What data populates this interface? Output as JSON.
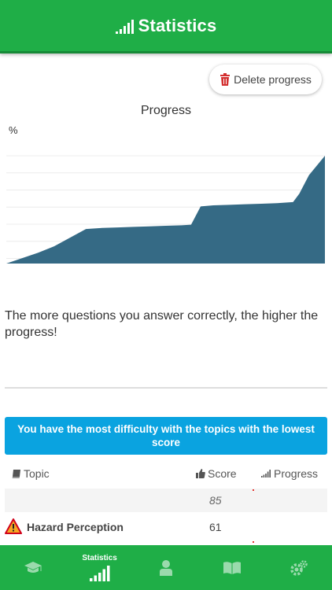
{
  "header": {
    "title": "Statistics",
    "icon": "signal-bars-icon"
  },
  "toolbar": {
    "delete_label": "Delete progress",
    "delete_icon": "trash-icon",
    "accent": "#d32f2f"
  },
  "chart_data": {
    "type": "area",
    "title": "Progress",
    "ylabel": "%",
    "x": [
      0,
      5,
      10,
      15,
      20,
      25,
      30,
      35,
      40,
      45,
      50,
      55,
      58,
      61,
      65,
      70,
      75,
      80,
      85,
      90,
      92,
      95,
      100
    ],
    "values": [
      0,
      5,
      10,
      16,
      24,
      32,
      33,
      33.5,
      34,
      34.5,
      35,
      35.5,
      36,
      53,
      54,
      54.5,
      55,
      55.5,
      56,
      57,
      65,
      82,
      100
    ],
    "ylim": [
      0,
      100
    ],
    "grid": true,
    "color": "#356a85"
  },
  "info": {
    "text": "The more questions you answer correctly, the higher the progress!"
  },
  "banner": {
    "text": "You have the most difficulty with the topics with the lowest score",
    "color": "#0aa3e0"
  },
  "table": {
    "headers": {
      "topic": "Topic",
      "score": "Score",
      "progress": "Progress"
    },
    "rows": [
      {
        "topic": "",
        "score": "85"
      },
      {
        "topic": "Hazard Perception",
        "score": "61"
      }
    ]
  },
  "footer": {
    "active_label": "Statistics",
    "items": [
      {
        "name": "learn",
        "icon": "graduation-cap-icon"
      },
      {
        "name": "statistics",
        "icon": "signal-bars-icon"
      },
      {
        "name": "profile",
        "icon": "user-icon"
      },
      {
        "name": "book",
        "icon": "book-icon"
      },
      {
        "name": "settings",
        "icon": "gears-icon"
      }
    ]
  }
}
